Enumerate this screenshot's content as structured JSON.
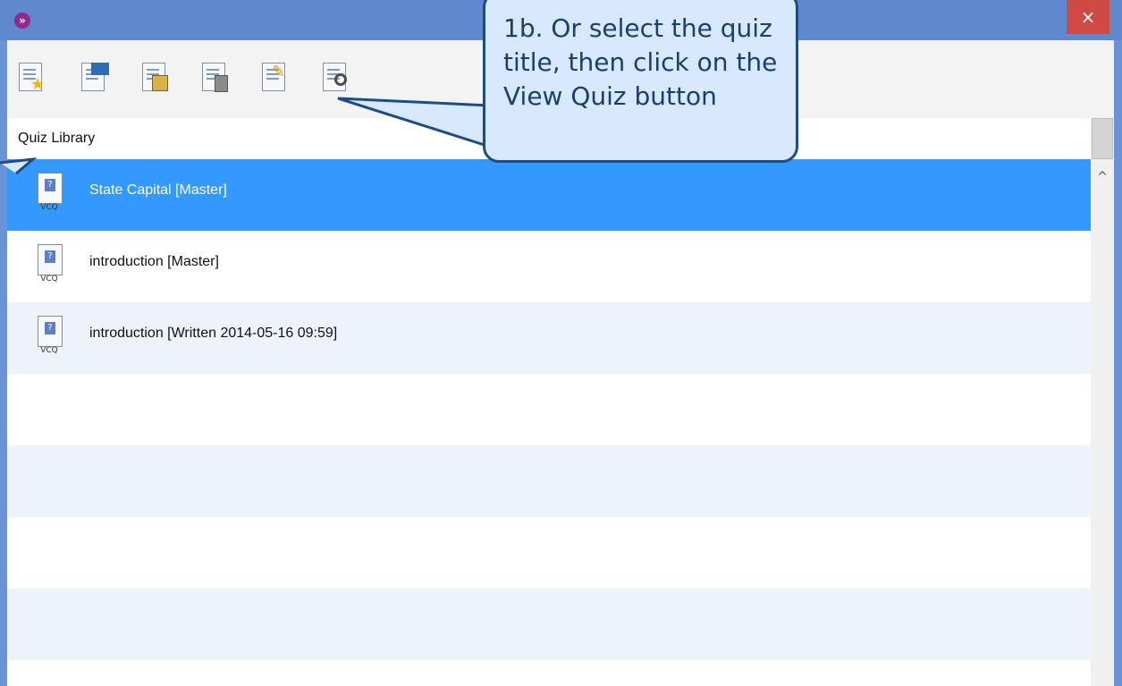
{
  "titlebar": {
    "app_icon": "forward-arrow-icon",
    "close_glyph": "×"
  },
  "toolbar": {
    "buttons": [
      {
        "name": "new-quiz-button",
        "icon": "star-doc-icon"
      },
      {
        "name": "import-quiz-button",
        "icon": "import-doc-icon"
      },
      {
        "name": "save-quiz-button",
        "icon": "save-doc-icon"
      },
      {
        "name": "delete-quiz-button",
        "icon": "trash-doc-icon"
      },
      {
        "name": "edit-quiz-button",
        "icon": "pencil-doc-icon"
      },
      {
        "name": "view-quiz-button",
        "icon": "magnifier-doc-icon"
      }
    ]
  },
  "library": {
    "header": "Quiz Library",
    "items": [
      {
        "label": "State Capital [Master]",
        "selected": true,
        "tag": "VCQ"
      },
      {
        "label": "introduction [Master]",
        "selected": false,
        "tag": "VCQ"
      },
      {
        "label": "introduction [Written 2014-05-16 09:59]",
        "selected": false,
        "tag": "VCQ"
      }
    ]
  },
  "callout": {
    "text": "1b. Or select the quiz title, then click on the View Quiz button"
  },
  "colors": {
    "titlebar": "#5f88cf",
    "selected_row": "#3399ff",
    "close": "#cf4a45",
    "callout_bg": "#d7e8ff",
    "callout_border": "#1d4c85"
  }
}
